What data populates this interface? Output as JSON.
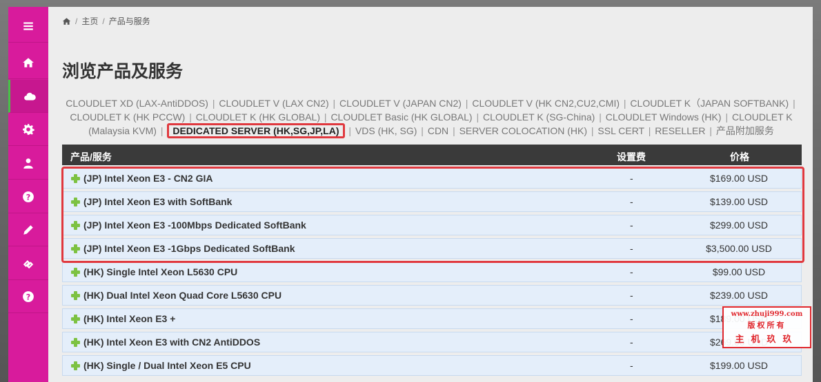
{
  "breadcrumb": {
    "home": "主页",
    "current": "产品与服务"
  },
  "page_title": "浏览产品及服务",
  "categories": [
    "CLOUDLET XD (LAX-AntiDDOS)",
    "CLOUDLET V (LAX CN2)",
    "CLOUDLET V (JAPAN CN2)",
    "CLOUDLET V (HK CN2,CU2,CMI)",
    "CLOUDLET K（JAPAN SOFTBANK)",
    "CLOUDLET K (HK PCCW)",
    "CLOUDLET K (HK GLOBAL)",
    "CLOUDLET Basic (HK GLOBAL)",
    "CLOUDLET K (SG-China)",
    "CLOUDLET Windows (HK)",
    "CLOUDLET K (Malaysia KVM)",
    "DEDICATED SERVER (HK,SG,JP,LA)",
    "VDS (HK, SG)",
    "CDN",
    "SERVER COLOCATION (HK)",
    "SSL CERT",
    "RESELLER",
    "产品附加服务"
  ],
  "selected_category": "DEDICATED SERVER (HK,SG,JP,LA)",
  "table": {
    "headers": {
      "product": "产品/服务",
      "setup": "设置费",
      "price": "价格"
    },
    "rows": [
      {
        "name": "(JP) Intel Xeon E3 - CN2 GIA",
        "setup": "-",
        "price": "$169.00 USD"
      },
      {
        "name": "(JP) Intel Xeon E3 with SoftBank",
        "setup": "-",
        "price": "$139.00 USD"
      },
      {
        "name": "(JP) Intel Xeon E3 -100Mbps Dedicated SoftBank",
        "setup": "-",
        "price": "$299.00 USD"
      },
      {
        "name": "(JP) Intel Xeon E3 -1Gbps Dedicated SoftBank",
        "setup": "-",
        "price": "$3,500.00 USD"
      },
      {
        "name": "(HK) Single Intel Xeon L5630 CPU",
        "setup": "-",
        "price": "$99.00 USD"
      },
      {
        "name": "(HK) Dual Intel Xeon Quad Core L5630 CPU",
        "setup": "-",
        "price": "$239.00 USD"
      },
      {
        "name": "(HK) Intel Xeon E3 +",
        "setup": "-",
        "price": "$189.00 USD"
      },
      {
        "name": "(HK) Intel Xeon E3 with CN2 AntiDDOS",
        "setup": "-",
        "price": "$269.00 USD"
      },
      {
        "name": "(HK) Single / Dual Intel Xeon E5 CPU",
        "setup": "-",
        "price": "$199.00 USD"
      }
    ]
  },
  "sidebar_icons": [
    "menu-icon",
    "home-icon",
    "cloud-icon",
    "gear-icon",
    "user-icon",
    "help-icon",
    "pencil-icon",
    "link-icon",
    "help-icon"
  ],
  "watermark": {
    "url": "www.zhuji999.com",
    "line1": "版权所有",
    "line2": "主机玖玖"
  },
  "colors": {
    "sidebar": "#d81b9c",
    "active_indicator": "#48c248",
    "highlight": "#e0383e",
    "row_bg": "#e4eefa",
    "plus": "#7dc242"
  }
}
